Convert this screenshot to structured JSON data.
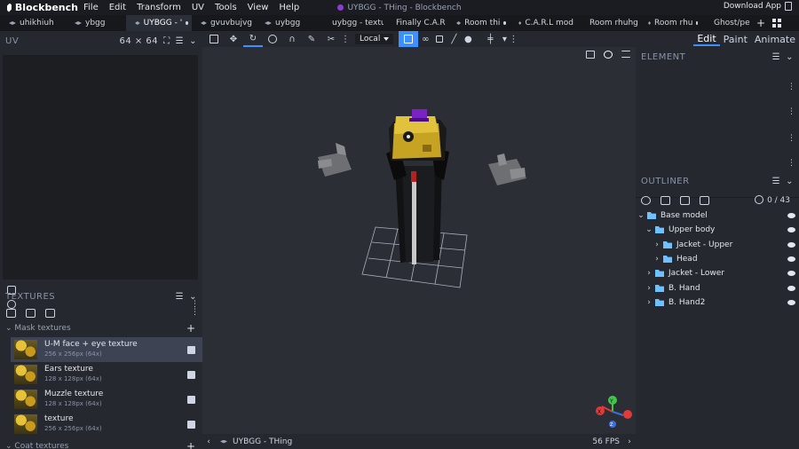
{
  "app": {
    "name": "Blockbench",
    "window_title": "UYBGG - THing - Blockbench",
    "download_label": "Download App"
  },
  "menu": [
    "File",
    "Edit",
    "Transform",
    "UV",
    "Tools",
    "View",
    "Help"
  ],
  "tabs": [
    {
      "label": "uhikhiuh",
      "active": false,
      "dot": false
    },
    {
      "label": "ybgg",
      "active": false,
      "dot": false
    },
    {
      "label": "UYBGG - '",
      "active": true,
      "dot": true
    },
    {
      "label": "gvuvbujvg",
      "active": false,
      "dot": false
    },
    {
      "label": "uybgg",
      "active": false,
      "dot": false
    },
    {
      "label": "uybgg - textu",
      "active": false,
      "dot": false
    },
    {
      "label": "Finally C.A.R",
      "active": false,
      "dot": false
    },
    {
      "label": "Room thi",
      "active": false,
      "dot": true
    },
    {
      "label": "C.A.R.L mod",
      "active": false,
      "dot": false
    },
    {
      "label": "Room rhuhg",
      "active": false,
      "dot": false
    },
    {
      "label": "Room rhu",
      "active": false,
      "dot": true
    },
    {
      "label": "Ghost/pe",
      "active": false,
      "dot": true
    }
  ],
  "uv_panel": {
    "title": "UV",
    "size_label": "64 × 64"
  },
  "textures_panel": {
    "title": "TEXTURES",
    "groups": [
      {
        "name": "Mask textures"
      },
      {
        "name": "Coat textures"
      }
    ],
    "items": [
      {
        "name": "U-M face + eye texture",
        "size": "256 x 256px (64x)",
        "selected": true
      },
      {
        "name": "Ears texture",
        "size": "128 x 128px (64x)",
        "selected": false
      },
      {
        "name": "Muzzle texture",
        "size": "128 x 128px (64x)",
        "selected": false
      },
      {
        "name": "texture",
        "size": "256 x 256px (64x)",
        "selected": false
      }
    ]
  },
  "toolbar": {
    "transform_space": "Local"
  },
  "statusbar": {
    "project": "UYBGG - THing",
    "fps": "56 FPS"
  },
  "modes": [
    "Edit",
    "Paint",
    "Animate"
  ],
  "active_mode": "Edit",
  "element_panel": {
    "title": "ELEMENT"
  },
  "outliner": {
    "title": "OUTLINER",
    "count": "0 / 43",
    "rows": [
      {
        "label": "Base model",
        "depth": 0,
        "expanded": true
      },
      {
        "label": "Upper body",
        "depth": 1,
        "expanded": true
      },
      {
        "label": "Jacket - Upper",
        "depth": 2,
        "expanded": false
      },
      {
        "label": "Head",
        "depth": 2,
        "expanded": false
      },
      {
        "label": "Jacket - Lower",
        "depth": 1,
        "expanded": false
      },
      {
        "label": "B. Hand",
        "depth": 1,
        "expanded": false
      },
      {
        "label": "B. Hand2",
        "depth": 1,
        "expanded": false
      }
    ]
  },
  "gizmo": {
    "x": "X",
    "y": "Y",
    "z": "Z"
  },
  "colors": {
    "accent": "#3e90ff",
    "folder": "#6ec0ff",
    "gizmo_x": "#e03a3a",
    "gizmo_y": "#44c44a",
    "gizmo_z": "#3a6ee0"
  }
}
